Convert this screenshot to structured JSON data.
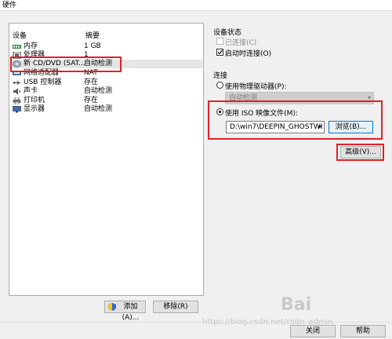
{
  "window": {
    "title": "硬件"
  },
  "device_list": {
    "col_device": "设备",
    "col_summary": "摘要",
    "items": [
      {
        "name": "内存",
        "summary": "1 GB",
        "icon": "memory-icon"
      },
      {
        "name": "处理器",
        "summary": "1",
        "icon": "processor-icon"
      },
      {
        "name": "新 CD/DVD (SAT...",
        "summary": "自动检测",
        "icon": "cd-dvd-icon"
      },
      {
        "name": "网络适配器",
        "summary": "NAT",
        "icon": "network-icon"
      },
      {
        "name": "USB 控制器",
        "summary": "存在",
        "icon": "usb-icon"
      },
      {
        "name": "声卡",
        "summary": "自动检测",
        "icon": "sound-icon"
      },
      {
        "name": "打印机",
        "summary": "存在",
        "icon": "printer-icon"
      },
      {
        "name": "显示器",
        "summary": "自动检测",
        "icon": "display-icon"
      }
    ],
    "add_button": "添加(A)...",
    "remove_button": "移除(R)"
  },
  "device_status": {
    "title": "设备状态",
    "connected": "已连接(C)",
    "connect_at_power_on": "启动时连接(O)"
  },
  "connection": {
    "title": "连接",
    "use_physical": "使用物理驱动器(P):",
    "physical_value": "自动检测",
    "use_iso": "使用 ISO 映像文件(M):",
    "iso_path": "D:\\win7\\DEEPIN_GHOSTWI",
    "browse_button": "浏览(B)...",
    "advanced_button": "高级(V)..."
  },
  "footer": {
    "close_button": "关闭",
    "help_button": "帮助"
  },
  "watermarks": {
    "baidu": "Bai",
    "blog": "https://blog.csdn.net/csdn_admin"
  }
}
